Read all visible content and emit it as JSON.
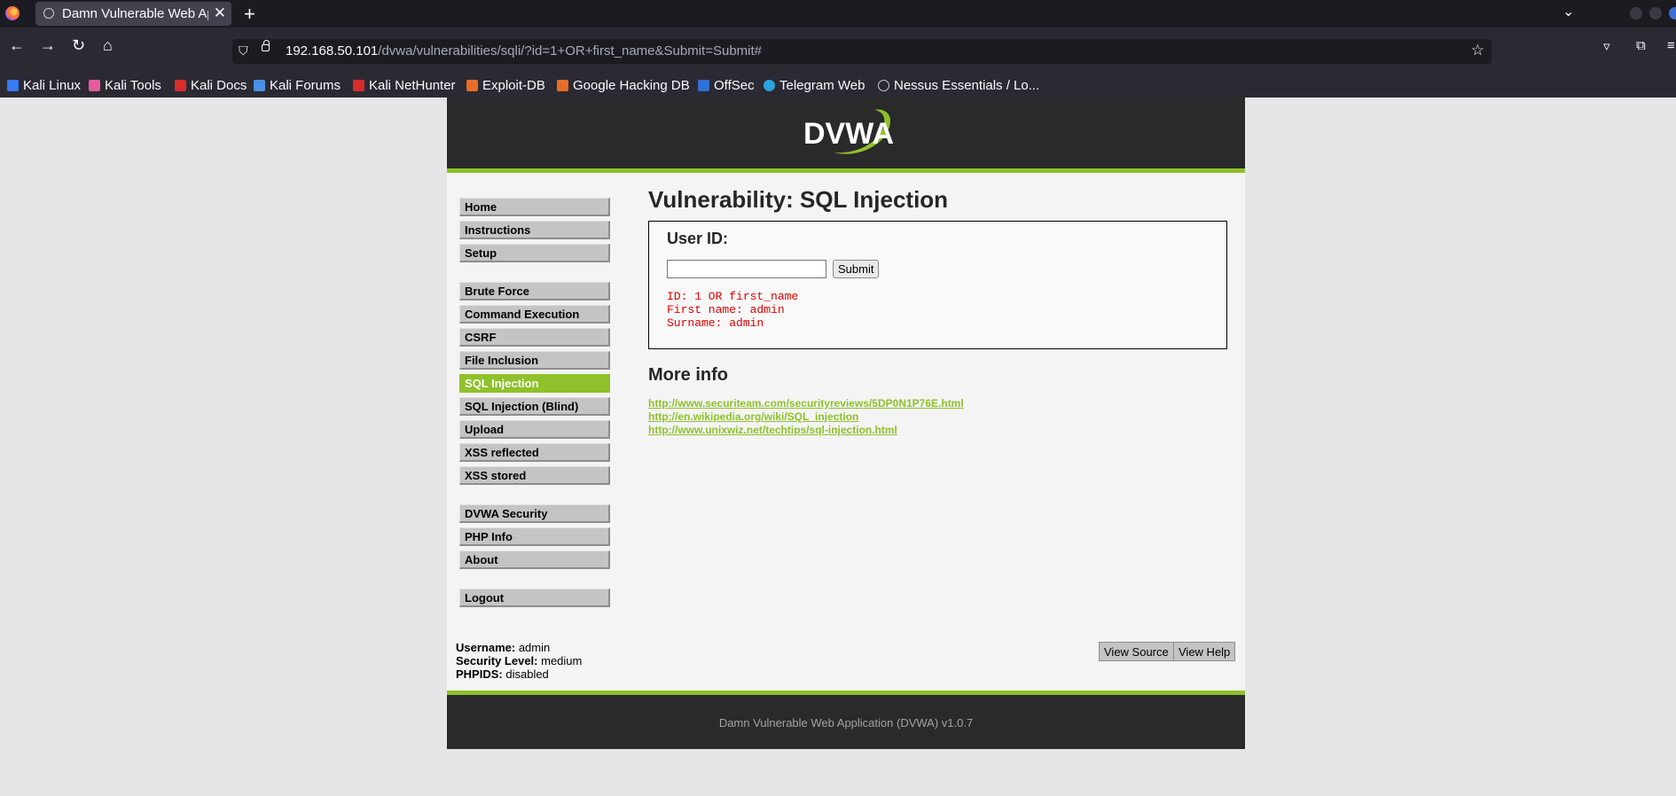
{
  "browser": {
    "tab_title": "Damn Vulnerable Web Ap",
    "url_host": "192.168.50.101",
    "url_path": "/dvwa/vulnerabilities/sqli/?id=1+OR+first_name&Submit=Submit#",
    "bookmarks": [
      {
        "label": "Kali Linux",
        "color": "#367bf0"
      },
      {
        "label": "Kali Tools",
        "color": "#e35b9d"
      },
      {
        "label": "Kali Docs",
        "color": "#d92b2b"
      },
      {
        "label": "Kali Forums",
        "color": "#4a90e2"
      },
      {
        "label": "Kali NetHunter",
        "color": "#d92b2b"
      },
      {
        "label": "Exploit-DB",
        "color": "#e86c28"
      },
      {
        "label": "Google Hacking DB",
        "color": "#e86c28"
      },
      {
        "label": "OffSec",
        "color": "#2f6fd6"
      },
      {
        "label": "Telegram Web",
        "color": "#2aa3df"
      },
      {
        "label": "Nessus Essentials / Lo...",
        "color": "#bbbbbb"
      }
    ]
  },
  "dvwa": {
    "logo_text": "DVWA",
    "menu": {
      "home": "Home",
      "instructions": "Instructions",
      "setup": "Setup",
      "brute_force": "Brute Force",
      "command_execution": "Command Execution",
      "csrf": "CSRF",
      "file_inclusion": "File Inclusion",
      "sql_injection": "SQL Injection",
      "sql_injection_blind": "SQL Injection (Blind)",
      "upload": "Upload",
      "xss_reflected": "XSS reflected",
      "xss_stored": "XSS stored",
      "dvwa_security": "DVWA Security",
      "php_info": "PHP Info",
      "about": "About",
      "logout": "Logout"
    },
    "page_title": "Vulnerability: SQL Injection",
    "form": {
      "label": "User ID:",
      "input_value": "",
      "submit": "Submit"
    },
    "result_lines": "ID: 1 OR first_name\nFirst name: admin\nSurname: admin",
    "more_info_title": "More info",
    "links": [
      "http://www.securiteam.com/securityreviews/5DP0N1P76E.html",
      "http://en.wikipedia.org/wiki/SQL_injection",
      "http://www.unixwiz.net/techtips/sql-injection.html"
    ],
    "status": {
      "username_label": "Username:",
      "username": "admin",
      "security_label": "Security Level:",
      "security": "medium",
      "phpids_label": "PHPIDS:",
      "phpids": "disabled"
    },
    "view_source": "View Source",
    "view_help": "View Help",
    "footer": "Damn Vulnerable Web Application (DVWA) v1.0.7"
  }
}
